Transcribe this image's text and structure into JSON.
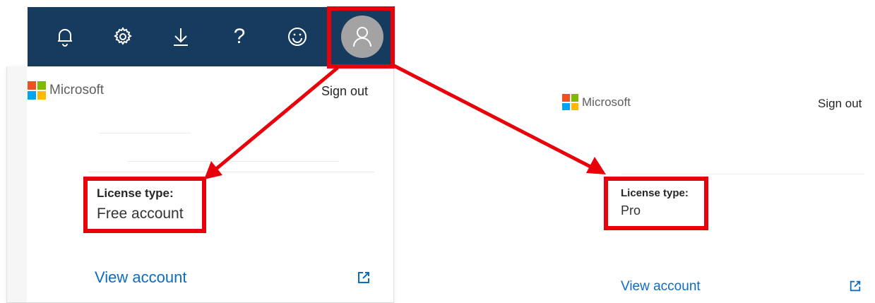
{
  "topbar": {
    "icons": [
      "bell-icon",
      "gear-icon",
      "download-icon",
      "help-icon",
      "feedback-smiley-icon",
      "account-avatar-icon"
    ],
    "background": "#163b5f",
    "help_glyph": "?"
  },
  "left_panel": {
    "brand": "Microsoft",
    "sign_out": "Sign out",
    "license_label": "License type:",
    "license_value": "Free account",
    "view_account": "View account"
  },
  "right_panel": {
    "brand": "Microsoft",
    "sign_out": "Sign out",
    "license_label": "License type:",
    "license_value": "Pro",
    "view_account": "View account"
  },
  "colors": {
    "highlight": "#e8000b",
    "link": "#0f6cbd",
    "ms_red": "#f25022",
    "ms_green": "#7fba00",
    "ms_blue": "#00a4ef",
    "ms_yellow": "#ffb900"
  }
}
